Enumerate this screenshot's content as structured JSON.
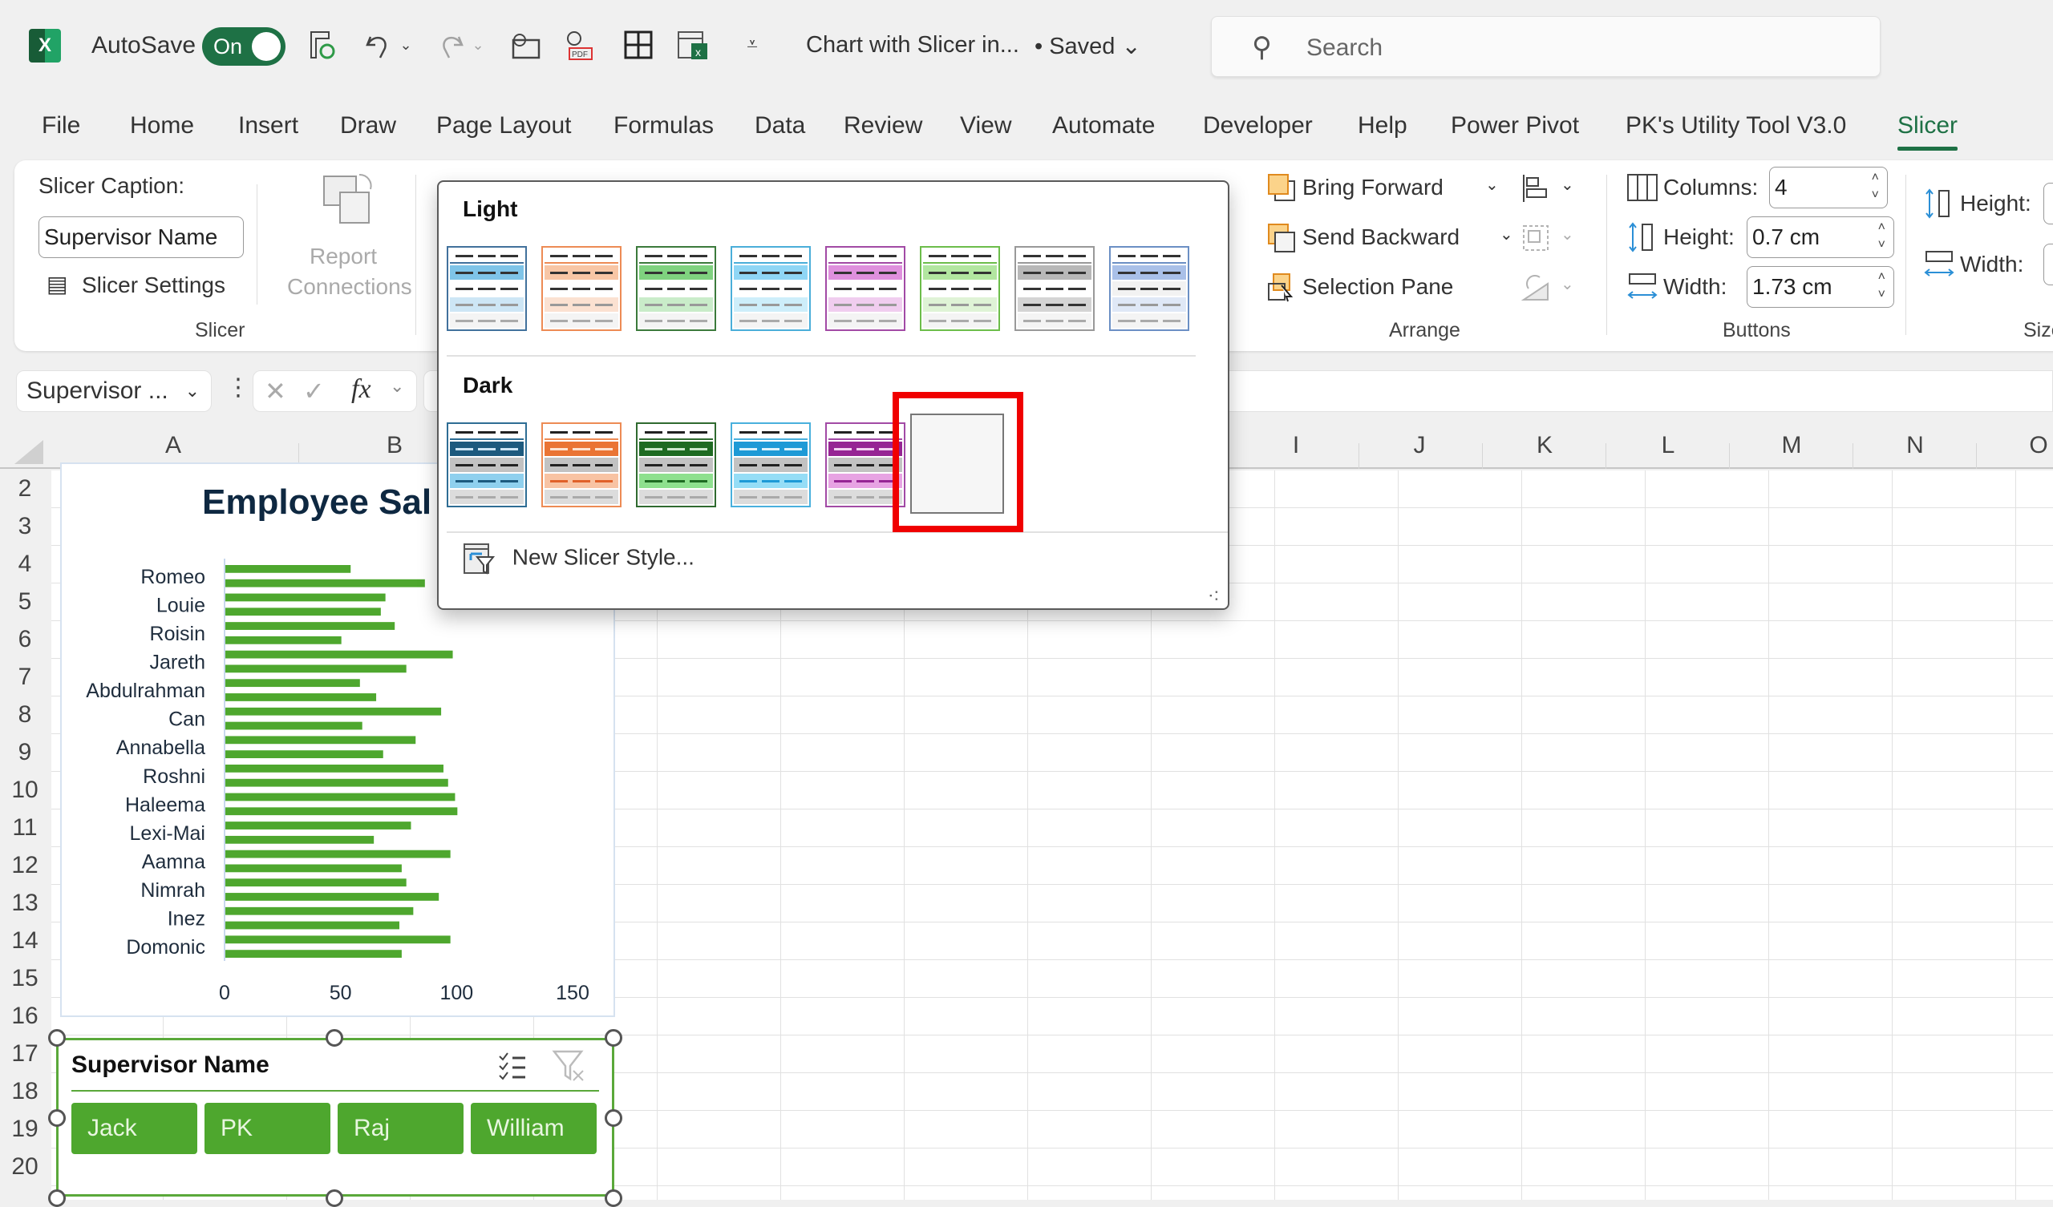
{
  "app": {
    "autosave_label": "AutoSave",
    "autosave_state": "On",
    "doc_title": "Chart with Slicer in...",
    "saved_status": "• Saved",
    "search_placeholder": "Search",
    "quick_access_icons": [
      "save-sync-icon",
      "undo-icon",
      "redo-icon",
      "email-attach-icon",
      "pdf-attach-icon",
      "borders-icon",
      "excel-sheet-icon",
      "customize-toolbar-icon"
    ]
  },
  "tabs": [
    {
      "label": "File"
    },
    {
      "label": "Home"
    },
    {
      "label": "Insert"
    },
    {
      "label": "Draw"
    },
    {
      "label": "Page Layout"
    },
    {
      "label": "Formulas"
    },
    {
      "label": "Data"
    },
    {
      "label": "Review"
    },
    {
      "label": "View"
    },
    {
      "label": "Automate"
    },
    {
      "label": "Developer"
    },
    {
      "label": "Help"
    },
    {
      "label": "Power Pivot"
    },
    {
      "label": "PK's Utility Tool V3.0"
    },
    {
      "label": "Slicer",
      "active": true
    }
  ],
  "ribbon": {
    "slicer_group": {
      "caption_label": "Slicer Caption:",
      "caption_value": "Supervisor Name",
      "settings_label": "Slicer Settings",
      "report_connections_label_1": "Report",
      "report_connections_label_2": "Connections",
      "group_label": "Slicer"
    },
    "arrange_group": {
      "bring_forward": "Bring Forward",
      "send_backward": "Send Backward",
      "selection_pane": "Selection Pane",
      "group_label": "Arrange"
    },
    "buttons_group": {
      "columns_label": "Columns:",
      "columns_value": "4",
      "height_label": "Height:",
      "height_value": "0.7 cm",
      "width_label": "Width:",
      "width_value": "1.73 cm",
      "group_label": "Buttons"
    },
    "size_group": {
      "height_label": "Height:",
      "width_label": "Width:",
      "group_label": "Size"
    }
  },
  "formula_bar": {
    "name_box": "Supervisor ...",
    "fx_label": "fx"
  },
  "grid": {
    "columns": [
      "A",
      "B",
      "I",
      "J",
      "K",
      "L",
      "M",
      "N",
      "O"
    ],
    "rows": [
      "2",
      "3",
      "4",
      "5",
      "6",
      "7",
      "8",
      "9",
      "10",
      "11",
      "12",
      "13",
      "14",
      "15",
      "16",
      "17",
      "18",
      "19",
      "20"
    ]
  },
  "style_popup": {
    "light_heading": "Light",
    "dark_heading": "Dark",
    "new_style_label": "New Slicer Style...",
    "light_styles": [
      {
        "border": "#41719c",
        "header": "#ffffff",
        "sel": "#7fc4e8",
        "row": "#ffffff",
        "alt": "#cde6f5",
        "last": "#f4f4f4",
        "dash": "#333",
        "altdash": "#999"
      },
      {
        "border": "#ed8b54",
        "header": "#ffffff",
        "sel": "#f8c6a5",
        "row": "#ffffff",
        "alt": "#fbe1d1",
        "last": "#f4f4f4",
        "dash": "#333",
        "altdash": "#999"
      },
      {
        "border": "#3b7a3b",
        "header": "#ffffff",
        "sel": "#7fd27f",
        "row": "#ffffff",
        "alt": "#c9ecc9",
        "last": "#f4f4f4",
        "dash": "#333",
        "altdash": "#999"
      },
      {
        "border": "#4aaed9",
        "header": "#ffffff",
        "sel": "#8fd6f5",
        "row": "#ffffff",
        "alt": "#cdeefa",
        "last": "#f4f4f4",
        "dash": "#333",
        "altdash": "#999"
      },
      {
        "border": "#a24aa5",
        "header": "#ffffff",
        "sel": "#df90dd",
        "row": "#ffffff",
        "alt": "#f0cdef",
        "last": "#f4f4f4",
        "dash": "#333",
        "altdash": "#999"
      },
      {
        "border": "#6cbd4a",
        "header": "#ffffff",
        "sel": "#b2e6a0",
        "row": "#ffffff",
        "alt": "#dff3d6",
        "last": "#f4f4f4",
        "dash": "#333",
        "altdash": "#999"
      },
      {
        "border": "#999999",
        "header": "#ffffff",
        "sel": "#b8b8b8",
        "row": "#ffffff",
        "alt": "#d4d4d4",
        "last": "#f4f4f4",
        "dash": "#333",
        "altdash": "#333"
      },
      {
        "border": "#6b8fc4",
        "header": "#ffffff",
        "sel": "#a9c0e8",
        "row": "#f2f2f2",
        "alt": "#dfe8f6",
        "last": "#f4f4f4",
        "dash": "#333",
        "altdash": "#999"
      }
    ],
    "dark_styles": [
      {
        "border": "#2e6d94",
        "header": "#ffffff",
        "sel": "#1d5a7e",
        "row": "#c2c2c2",
        "alt": "#8fd0ee",
        "last": "#dcdcdc",
        "seldash": "#cfe6f5",
        "dash": "#222",
        "altdash": "#1d5a7e"
      },
      {
        "border": "#ed8b54",
        "header": "#ffffff",
        "sel": "#ea7434",
        "row": "#c2c2c2",
        "alt": "#f8c3a3",
        "last": "#dcdcdc",
        "seldash": "#fde3d2",
        "dash": "#222",
        "altdash": "#e0612a"
      },
      {
        "border": "#2f6a2f",
        "header": "#ffffff",
        "sel": "#1e6b22",
        "row": "#c2c2c2",
        "alt": "#8ee08e",
        "last": "#dcdcdc",
        "seldash": "#cce8cc",
        "dash": "#222",
        "altdash": "#1e6b22"
      },
      {
        "border": "#49b0dd",
        "header": "#ffffff",
        "sel": "#1e9ad6",
        "row": "#c2c2c2",
        "alt": "#95ddf6",
        "last": "#dcdcdc",
        "seldash": "#dff3fb",
        "dash": "#222",
        "altdash": "#1e9ad6"
      },
      {
        "border": "#a24aa5",
        "header": "#ffffff",
        "sel": "#962594",
        "row": "#c2c2c2",
        "alt": "#e7a3e3",
        "last": "#dcdcdc",
        "seldash": "#f3d4f2",
        "dash": "#222",
        "altdash": "#962594"
      },
      {
        "border": "#6cbd4a",
        "header": "#ffffff",
        "sel": "#4ea72e",
        "row": "#c2c2c2",
        "alt": "#b6e69c",
        "last": "#dcdcdc",
        "seldash": "#e3f5d8",
        "dash": "#222",
        "altdash": "#4ea72e",
        "selected": true
      }
    ],
    "highlight_color": "#f00000"
  },
  "slicer": {
    "title": "Supervisor Name",
    "border_color": "#5aa83a",
    "button_color": "#4ea72e",
    "items": [
      {
        "label": "Jack",
        "selected": true
      },
      {
        "label": "PK",
        "selected": true
      },
      {
        "label": "Raj",
        "selected": true
      },
      {
        "label": "William",
        "selected": true
      }
    ]
  },
  "chart_data": {
    "type": "bar",
    "orientation": "horizontal",
    "title": "Employee Sal",
    "title_note": "title partially hidden behind style gallery popup",
    "bar_color": "#4ea72e",
    "categories_labeled": [
      "Romeo",
      "Louie",
      "Roisin",
      "Jareth",
      "Abdulrahman",
      "Can",
      "Annabella",
      "Roshni",
      "Haleema",
      "Lexi-Mai",
      "Aamna",
      "Nimrah",
      "Inez",
      "Domonic"
    ],
    "values": [
      54,
      86,
      69,
      67,
      73,
      50,
      98,
      78,
      58,
      65,
      93,
      59,
      82,
      68,
      94,
      96,
      99,
      100,
      80,
      64,
      97,
      76,
      78,
      92,
      81,
      75,
      97,
      76
    ],
    "label_every": 2,
    "xlabel": "",
    "ylabel": "",
    "xticks": [
      "0",
      "50",
      "100",
      "150"
    ],
    "xlim": [
      0,
      150
    ],
    "grid": false,
    "legend": "none"
  }
}
